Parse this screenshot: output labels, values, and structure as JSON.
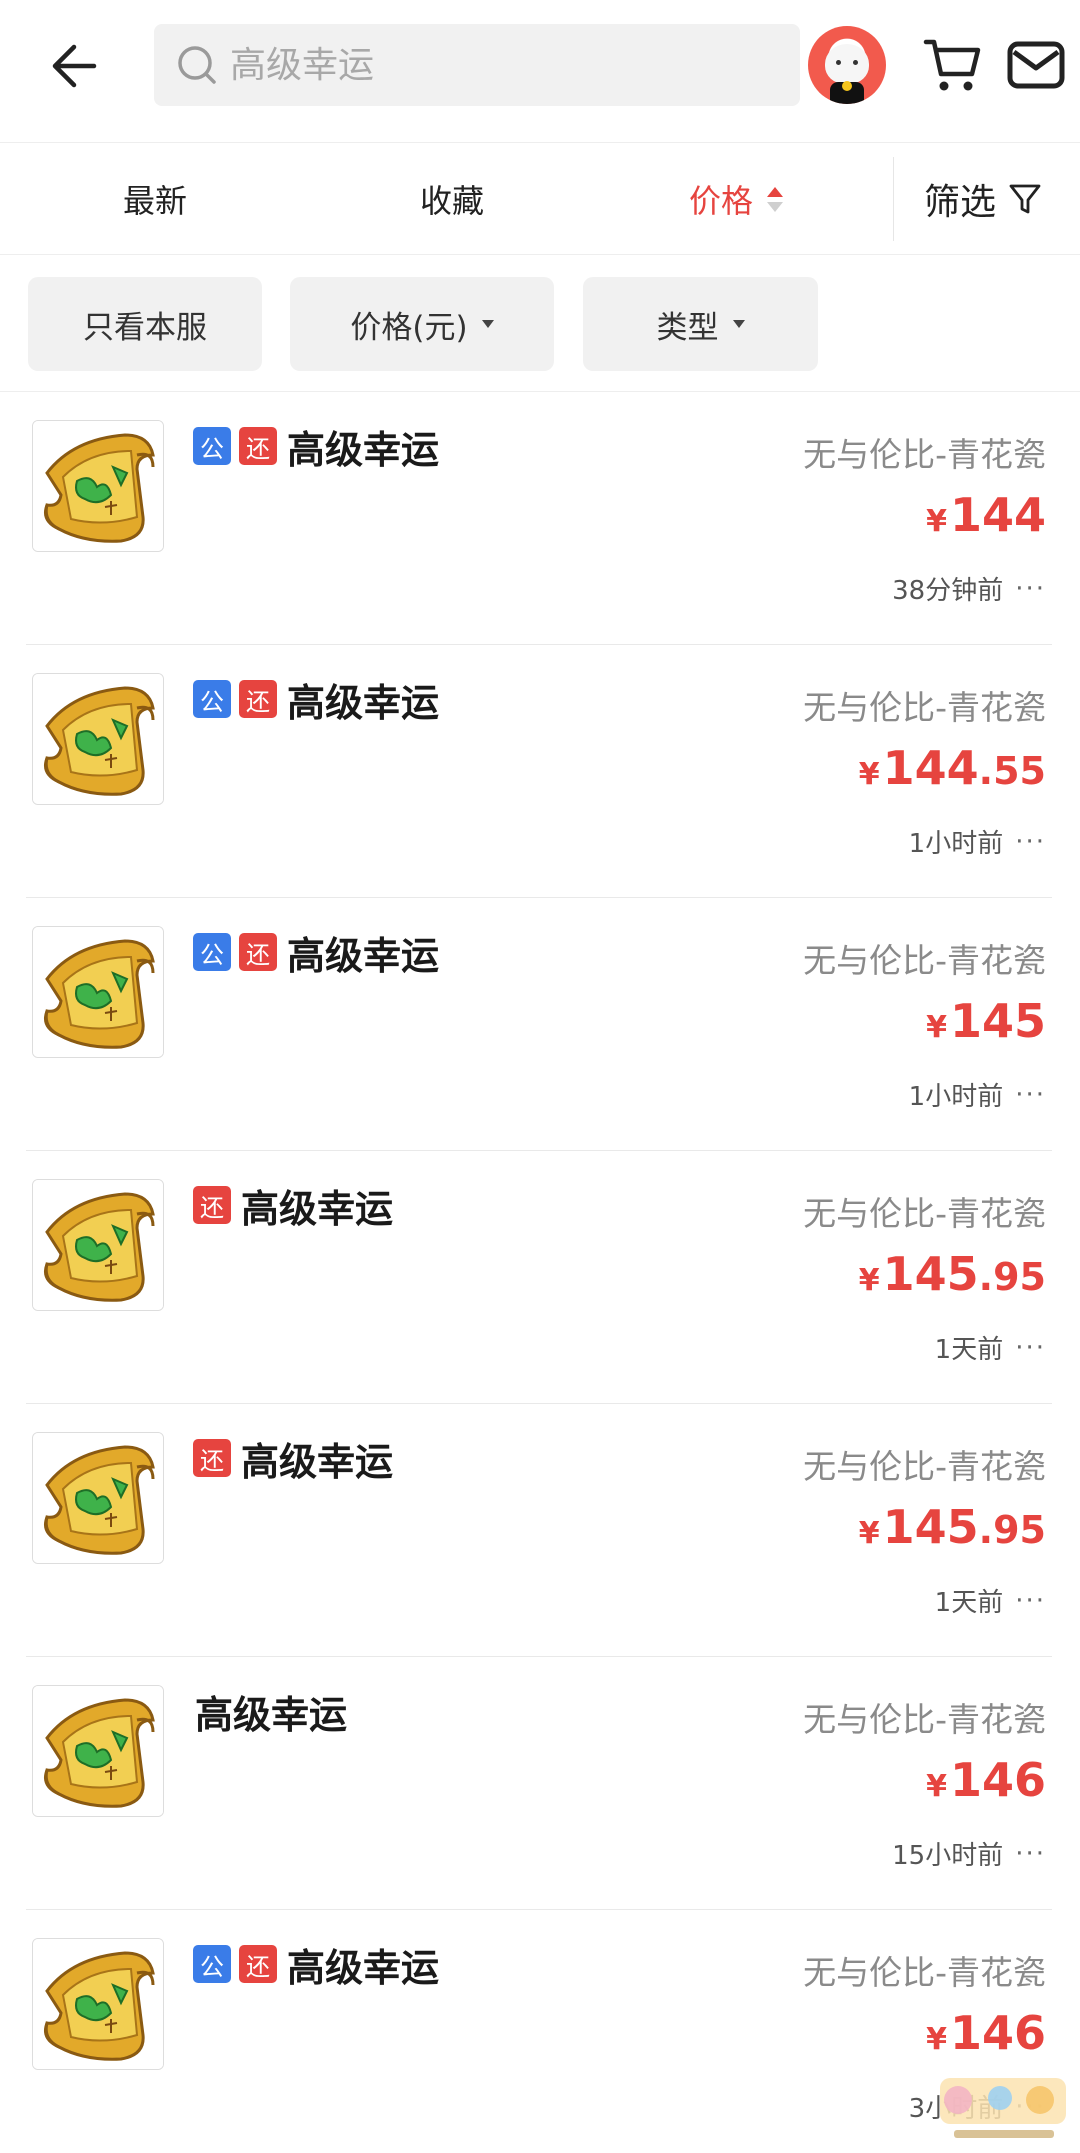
{
  "header": {
    "search_placeholder": "高级幸运",
    "icons": [
      "back-arrow-icon",
      "search-icon",
      "avatar",
      "cart-icon",
      "mail-icon"
    ]
  },
  "sort": {
    "latest": "最新",
    "favorites": "收藏",
    "price": "价格",
    "filter": "筛选"
  },
  "chips": {
    "only_server": "只看本服",
    "price_yuan": "价格(元)",
    "type": "类型"
  },
  "listings": [
    {
      "tags": [
        "公",
        "还"
      ],
      "title": "高级幸运",
      "server": "无与伦比-青花瓷",
      "currency": "¥",
      "price_int": "144",
      "price_dec": "",
      "time": "38分钟前",
      "more": "···"
    },
    {
      "tags": [
        "公",
        "还"
      ],
      "title": "高级幸运",
      "server": "无与伦比-青花瓷",
      "currency": "¥",
      "price_int": "144",
      "price_dec": ".55",
      "time": "1小时前",
      "more": "···"
    },
    {
      "tags": [
        "公",
        "还"
      ],
      "title": "高级幸运",
      "server": "无与伦比-青花瓷",
      "currency": "¥",
      "price_int": "145",
      "price_dec": "",
      "time": "1小时前",
      "more": "···"
    },
    {
      "tags": [
        "还"
      ],
      "title": "高级幸运",
      "server": "无与伦比-青花瓷",
      "currency": "¥",
      "price_int": "145",
      "price_dec": ".95",
      "time": "1天前",
      "more": "···"
    },
    {
      "tags": [
        "还"
      ],
      "title": "高级幸运",
      "server": "无与伦比-青花瓷",
      "currency": "¥",
      "price_int": "145",
      "price_dec": ".95",
      "time": "1天前",
      "more": "···"
    },
    {
      "tags": [],
      "title": "高级幸运",
      "server": "无与伦比-青花瓷",
      "currency": "¥",
      "price_int": "146",
      "price_dec": "",
      "time": "15小时前",
      "more": "···"
    },
    {
      "tags": [
        "公",
        "还"
      ],
      "title": "高级幸运",
      "server": "无与伦比-青花瓷",
      "currency": "¥",
      "price_int": "146",
      "price_dec": "",
      "time": "3小时前",
      "more": "···"
    }
  ],
  "colors": {
    "accent_red": "#e6443f",
    "tag_blue": "#3a7ce8",
    "chip_bg": "#f1f1f1"
  }
}
